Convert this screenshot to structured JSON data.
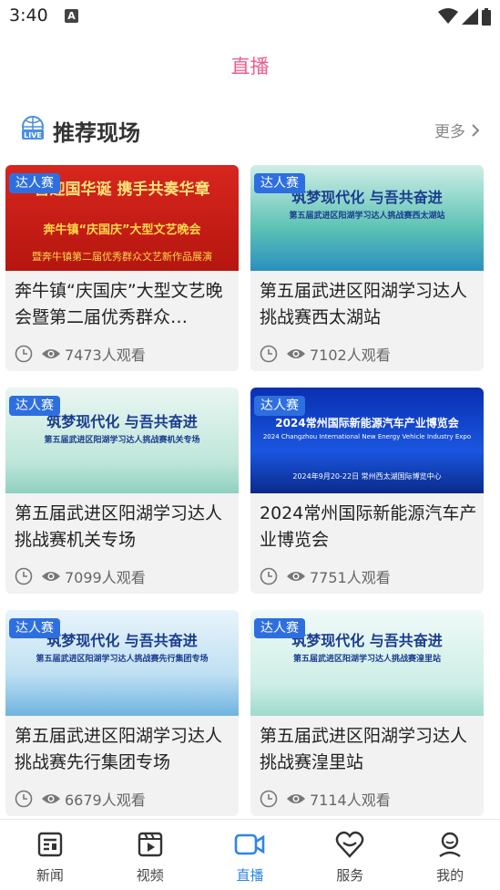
{
  "status": {
    "time": "3:40",
    "indicator": "A"
  },
  "page": {
    "title": "直播"
  },
  "section": {
    "title": "推荐现场",
    "more": "更多"
  },
  "cards": [
    {
      "badge": "达人赛",
      "thumb_line1": "喜迎国华诞 携手共奏华章",
      "thumb_line2": "奔牛镇“庆国庆”大型文艺晚会",
      "thumb_line3": "暨奔牛镇第二届优秀群众文艺新作品展演",
      "title": "奔牛镇“庆国庆”大型文艺晚会暨第二届优秀群众…",
      "views": "7473人观看"
    },
    {
      "badge": "达人赛",
      "thumb_line1": "筑梦现代化 与吾共奋进",
      "thumb_line2": "第五届武进区阳湖学习达人挑战赛西太湖站",
      "thumb_line3": "",
      "title": "第五届武进区阳湖学习达人挑战赛西太湖站",
      "views": "7102人观看"
    },
    {
      "badge": "达人赛",
      "thumb_line1": "筑梦现代化 与吾共奋进",
      "thumb_line2": "第五届武进区阳湖学习达人挑战赛机关专场",
      "thumb_line3": "",
      "title": "第五届武进区阳湖学习达人挑战赛机关专场",
      "views": "7099人观看"
    },
    {
      "badge": "达人赛",
      "thumb_line1": "2024常州国际新能源汽车产业博览会",
      "thumb_line2": "2024 Changzhou International New Energy Vehicle Industry Expo",
      "thumb_line3": "2024年9月20-22日 常州西太湖国际博览中心",
      "title": "2024常州国际新能源汽车产业博览会",
      "views": "7751人观看"
    },
    {
      "badge": "达人赛",
      "thumb_line1": "筑梦现代化 与吾共奋进",
      "thumb_line2": "第五届武进区阳湖学习达人挑战赛先行集团专场",
      "thumb_line3": "",
      "title": "第五届武进区阳湖学习达人挑战赛先行集团专场",
      "views": "6679人观看"
    },
    {
      "badge": "达人赛",
      "thumb_line1": "筑梦现代化 与吾共奋进",
      "thumb_line2": "第五届武进区阳湖学习达人挑战赛湟里站",
      "thumb_line3": "",
      "title": "第五届武进区阳湖学习达人挑战赛湟里站",
      "views": "7114人观看"
    }
  ],
  "tabs": [
    {
      "label": "新闻",
      "icon": "news-icon"
    },
    {
      "label": "视频",
      "icon": "video-icon"
    },
    {
      "label": "直播",
      "icon": "live-camera-icon",
      "active": true
    },
    {
      "label": "服务",
      "icon": "heart-service-icon"
    },
    {
      "label": "我的",
      "icon": "profile-icon"
    }
  ],
  "colors": {
    "accent": "#2e86e8",
    "title_pink": "#ec5f8c",
    "badge": "#2e6fe0"
  }
}
